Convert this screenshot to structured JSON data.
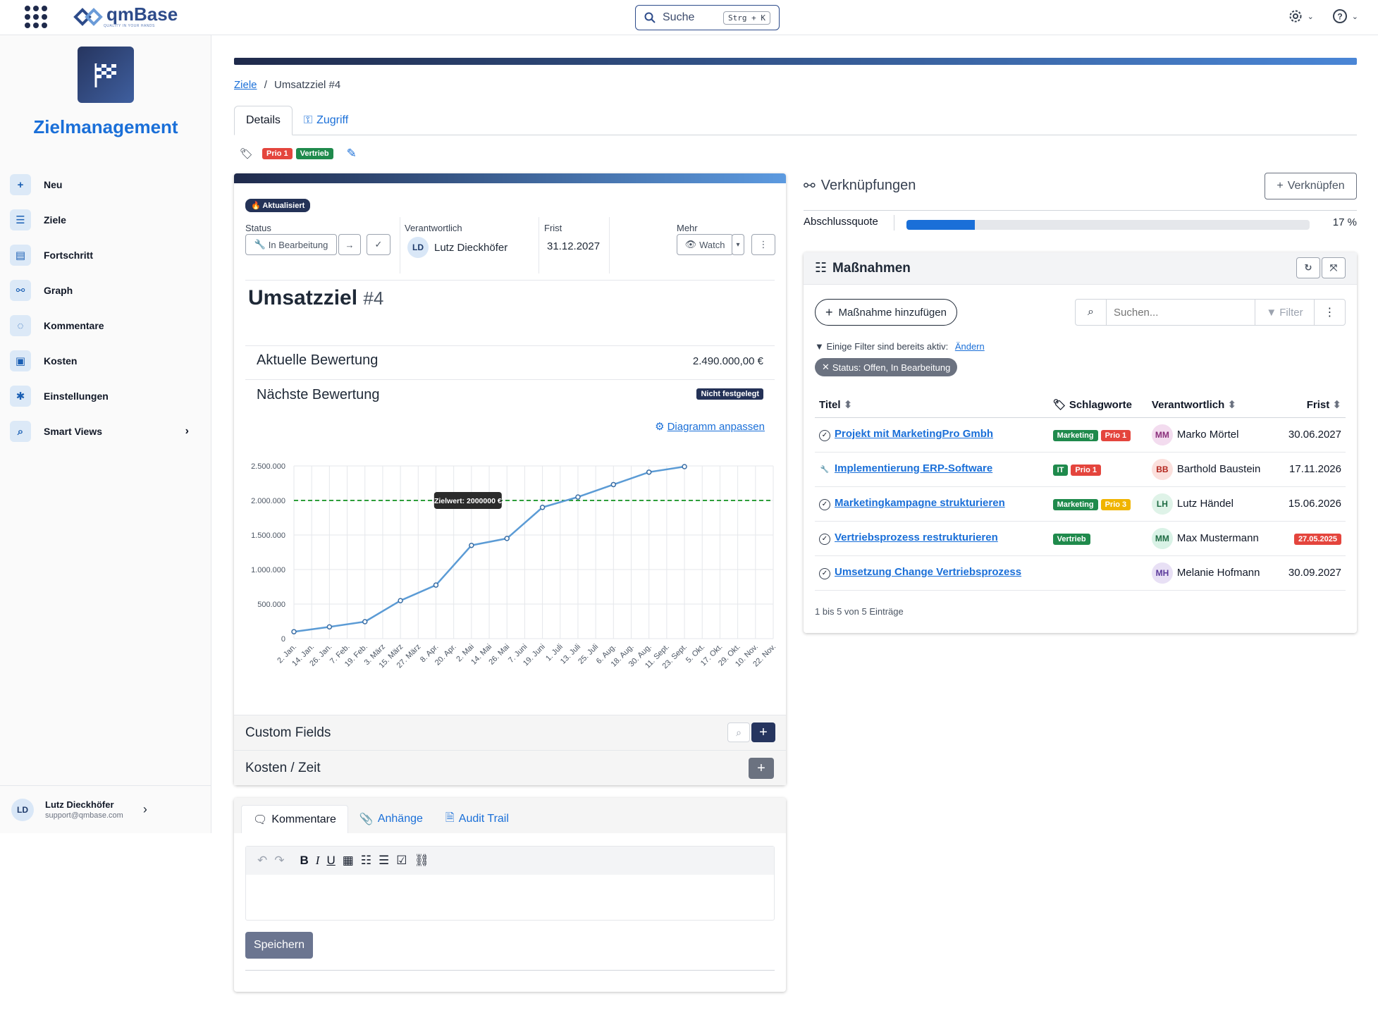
{
  "header": {
    "logo_text": "qmBase",
    "logo_sub": "QUALITY IN YOUR HANDS",
    "search_label": "Suche",
    "search_shortcut": "Strg + K"
  },
  "sidebar": {
    "app_title": "Zielmanagement",
    "items": [
      {
        "label": "Neu",
        "icon": "plus-icon"
      },
      {
        "label": "Ziele",
        "icon": "list-icon"
      },
      {
        "label": "Fortschritt",
        "icon": "chart-icon"
      },
      {
        "label": "Graph",
        "icon": "graph-icon"
      },
      {
        "label": "Kommentare",
        "icon": "comments-icon"
      },
      {
        "label": "Kosten",
        "icon": "money-icon"
      },
      {
        "label": "Einstellungen",
        "icon": "gear-icon"
      },
      {
        "label": "Smart Views",
        "icon": "search-icon"
      }
    ],
    "user": {
      "initials": "LD",
      "name": "Lutz Dieckhöfer",
      "email": "support@qmbase.com"
    }
  },
  "breadcrumb": {
    "link": "Ziele",
    "separator": "/",
    "current": "Umsatzziel #4"
  },
  "tabs": [
    {
      "label": "Details"
    },
    {
      "label": "Zugriff"
    }
  ],
  "tags": [
    "Prio 1",
    "Vertrieb"
  ],
  "details": {
    "updated_badge": "Aktualisiert",
    "status_label": "Status",
    "status_value": "In Bearbeitung",
    "responsible_label": "Verantwortlich",
    "responsible_initials": "LD",
    "responsible_name": "Lutz Dieckhöfer",
    "deadline_label": "Frist",
    "deadline_value": "31.12.2027",
    "more_label": "Mehr",
    "watch_label": "Watch",
    "title": "Umsatzziel",
    "number": "#4",
    "current_rating_label": "Aktuelle Bewertung",
    "current_rating_value": "2.490.000,00 €",
    "next_rating_label": "Nächste Bewertung",
    "next_rating_badge": "Nicht festgelegt",
    "chart_link": "Diagramm anpassen",
    "custom_fields": "Custom Fields",
    "costs_time": "Kosten / Zeit"
  },
  "chart_data": {
    "type": "line",
    "x": [
      "2. Jan.",
      "14. Jan.",
      "26. Jan.",
      "7. Feb.",
      "19. Feb.",
      "3. März",
      "15. März",
      "27. März",
      "8. Apr.",
      "20. Apr.",
      "2. Mai",
      "14. Mai",
      "26. Mai",
      "7. Juni",
      "19. Juni",
      "1. Juli",
      "13. Juli",
      "25. Juli",
      "6. Aug.",
      "18. Aug.",
      "30. Aug.",
      "11. Sept.",
      "23. Sept.",
      "5. Okt.",
      "17. Okt.",
      "29. Okt.",
      "10. Nov.",
      "22. Nov."
    ],
    "series": [
      {
        "points": [
          [
            0,
            100000
          ],
          [
            2,
            170000
          ],
          [
            4,
            245000
          ],
          [
            6,
            550000
          ],
          [
            8,
            775000
          ],
          [
            10,
            1350000
          ],
          [
            12,
            1450000
          ],
          [
            14,
            1900000
          ],
          [
            16,
            2050000
          ],
          [
            18,
            2230000
          ],
          [
            20,
            2410000
          ],
          [
            22,
            2490000
          ]
        ]
      }
    ],
    "y_ticks": [
      "0",
      "500.000",
      "1.000.000",
      "1.500.000",
      "2.000.000",
      "2.500.000"
    ],
    "ylim": [
      0,
      2500000
    ],
    "target_value": 2000000,
    "target_label": "Zielwert: 2000000 €",
    "grid": true,
    "line_color": "#5b9bd5",
    "target_color": "#2e9e3a"
  },
  "bottom": {
    "tabs": [
      {
        "label": "Kommentare"
      },
      {
        "label": "Anhänge"
      },
      {
        "label": "Audit Trail"
      }
    ],
    "save_label": "Speichern"
  },
  "links_panel": {
    "title": "Verknüpfungen",
    "link_button": "Verknüpfen",
    "completion_label": "Abschlussquote",
    "completion_value": "17 %",
    "completion_fraction": 0.17
  },
  "measures": {
    "title": "Maßnahmen",
    "add_button": "Maßnahme hinzufügen",
    "search_placeholder": "Suchen...",
    "filter_label": "Filter",
    "filter_hint": "Einige Filter sind bereits aktiv:",
    "filter_change": "Ändern",
    "active_filter": "Status: Offen, In Bearbeitung",
    "columns": [
      "Titel",
      "Schlagworte",
      "Verantwortlich",
      "Frist"
    ],
    "rows": [
      {
        "title": "Projekt mit MarketingPro Gmbh",
        "icon": "check-circle-icon",
        "tags": [
          {
            "t": "Marketing",
            "c": "b-green"
          },
          {
            "t": "Prio 1",
            "c": "b-red"
          }
        ],
        "initials": "MM",
        "person": "Marko Mörtel",
        "deadline": "30.06.2027",
        "overdue": false,
        "avbg": "#f3dcef",
        "avfg": "#8a2f7a"
      },
      {
        "title": "Implementierung ERP-Software",
        "icon": "wrench-icon",
        "tags": [
          {
            "t": "IT",
            "c": "b-green"
          },
          {
            "t": "Prio 1",
            "c": "b-red"
          }
        ],
        "initials": "BB",
        "person": "Barthold Baustein",
        "deadline": "17.11.2026",
        "overdue": false,
        "avbg": "#fbe0dd",
        "avfg": "#b3261e"
      },
      {
        "title": "Marketingkampagne strukturieren",
        "icon": "check-circle-icon",
        "tags": [
          {
            "t": "Marketing",
            "c": "b-green"
          },
          {
            "t": "Prio 3",
            "c": "b-yellow"
          }
        ],
        "initials": "LH",
        "person": "Lutz Händel",
        "deadline": "15.06.2026",
        "overdue": false,
        "avbg": "#dff3e8",
        "avfg": "#1e6b43"
      },
      {
        "title": "Vertriebsprozess restrukturieren",
        "icon": "check-circle-icon",
        "tags": [
          {
            "t": "Vertrieb",
            "c": "b-green"
          }
        ],
        "initials": "MM",
        "person": "Max Mustermann",
        "deadline": "27.05.2025",
        "overdue": true,
        "avbg": "#d9f2e6",
        "avfg": "#1e6b43"
      },
      {
        "title": "Umsetzung Change Vertriebsprozess",
        "icon": "check-circle-icon",
        "tags": [],
        "initials": "MH",
        "person": "Melanie Hofmann",
        "deadline": "30.09.2027",
        "overdue": false,
        "avbg": "#e8e0f5",
        "avfg": "#5b3a9b"
      }
    ],
    "footer": "1 bis 5 von 5 Einträge"
  }
}
